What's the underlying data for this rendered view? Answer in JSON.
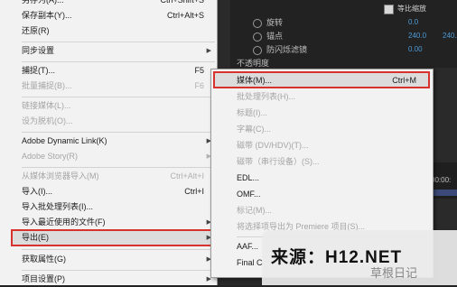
{
  "background": {
    "rows": [
      {
        "label": "旋转",
        "value": "0.0"
      },
      {
        "label": "锚点",
        "value": "240.0"
      },
      {
        "label": "防闪烁滤镜",
        "value": "0.00"
      },
      {
        "label": "不透明度",
        "value": ""
      }
    ],
    "value_extra": "240.",
    "checkbox_label": "等比缩放",
    "timeline_text": "00:00:"
  },
  "menu": {
    "items": [
      {
        "label": "另存为(A)...",
        "key": "Ctrl+Shift+S"
      },
      {
        "label": "保存副本(Y)...",
        "key": "Ctrl+Alt+S"
      },
      {
        "label": "还原(R)",
        "key": ""
      },
      {
        "label": "同步设置",
        "key": ""
      },
      {
        "label": "捕捉(T)...",
        "key": "F5"
      },
      {
        "label": "批量捕捉(B)...",
        "key": "F6"
      },
      {
        "label": "链接媒体(L)...",
        "key": ""
      },
      {
        "label": "设为脱机(O)...",
        "key": ""
      },
      {
        "label": "Adobe Dynamic Link(K)",
        "key": ""
      },
      {
        "label": "Adobe Story(R)",
        "key": ""
      },
      {
        "label": "从媒体浏览器导入(M)",
        "key": "Ctrl+Alt+I"
      },
      {
        "label": "导入(I)...",
        "key": "Ctrl+I"
      },
      {
        "label": "导入批处理列表(I)...",
        "key": ""
      },
      {
        "label": "导入最近使用的文件(F)",
        "key": ""
      },
      {
        "label": "导出(E)",
        "key": ""
      },
      {
        "label": "获取属性(G)",
        "key": ""
      },
      {
        "label": "项目设置(P)",
        "key": ""
      }
    ]
  },
  "submenu": {
    "items": [
      {
        "label": "媒体(M)...",
        "key": "Ctrl+M"
      },
      {
        "label": "批处理列表(H)...",
        "key": ""
      },
      {
        "label": "标题(I)...",
        "key": ""
      },
      {
        "label": "字幕(C)...",
        "key": ""
      },
      {
        "label": "磁带 (DV/HDV)(T)...",
        "key": ""
      },
      {
        "label": "磁带（串行设备）(S)...",
        "key": ""
      },
      {
        "label": "EDL...",
        "key": ""
      },
      {
        "label": "OMF...",
        "key": ""
      },
      {
        "label": "标记(M)...",
        "key": ""
      },
      {
        "label": "将选择项导出为 Premiere 项目(S)...",
        "key": ""
      },
      {
        "label": "AAF...",
        "key": ""
      },
      {
        "label": "Final C",
        "key": ""
      }
    ]
  },
  "watermark": {
    "main": "来源：H12.NET",
    "sub": "草根日记"
  }
}
